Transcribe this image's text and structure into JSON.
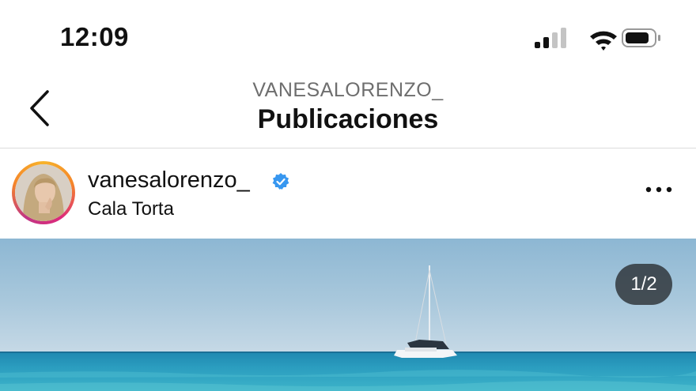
{
  "status_bar": {
    "time": "12:09",
    "signal_icon": "cellular-signal-icon",
    "wifi_icon": "wifi-icon",
    "battery_icon": "battery-icon",
    "battery_level": 0.72
  },
  "header": {
    "back_icon": "chevron-left-icon",
    "subtitle": "VANESALORENZO_",
    "title": "Publicaciones"
  },
  "post": {
    "username": "vanesalorenzo_",
    "verified_icon": "verified-badge-icon",
    "location": "Cala Torta",
    "more_icon": "more-horizontal-icon",
    "image_counter": "1/2"
  },
  "colors": {
    "sky": "#a9c8dc",
    "sea": "#2b9dbf",
    "verified": "#3797f0"
  }
}
